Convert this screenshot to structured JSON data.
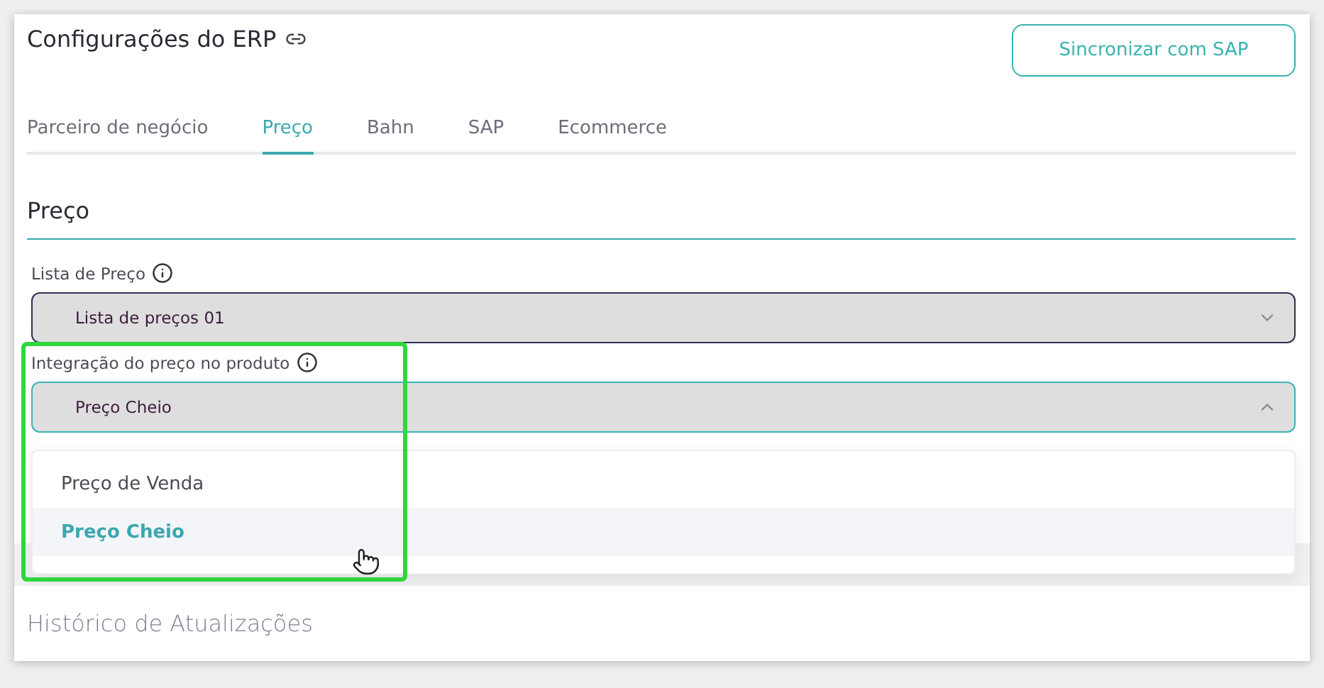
{
  "page": {
    "title": "Configurações do ERP",
    "sync_button": "Sincronizar com SAP"
  },
  "tabs": [
    {
      "label": "Parceiro de negócio",
      "selected": false
    },
    {
      "label": "Preço",
      "selected": true
    },
    {
      "label": "Bahn",
      "selected": false
    },
    {
      "label": "SAP",
      "selected": false
    },
    {
      "label": "Ecommerce",
      "selected": false
    }
  ],
  "section": {
    "title": "Preço"
  },
  "fields": [
    {
      "label": "Lista de Preço",
      "value": "Lista de preços 01",
      "expanded": false
    },
    {
      "label": "Integração do preço no produto",
      "value": "Preço Cheio",
      "expanded": true
    }
  ],
  "dropdown": {
    "options": [
      {
        "label": "Preço de Venda",
        "selected": false
      },
      {
        "label": "Preço Cheio",
        "selected": true
      }
    ]
  },
  "history": {
    "title": "Histórico de Atualizações"
  }
}
